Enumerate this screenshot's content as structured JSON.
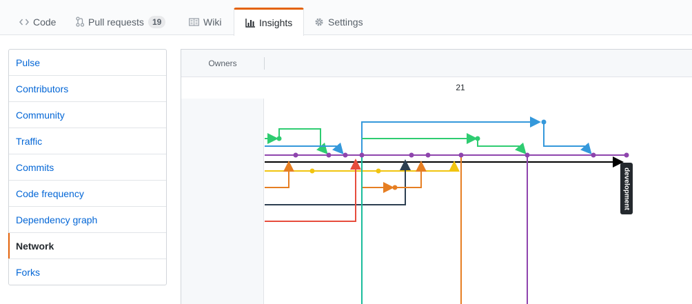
{
  "tabs": [
    {
      "label": "Code",
      "icon": "code-icon"
    },
    {
      "label": "Pull requests",
      "icon": "git-pull-request-icon",
      "count": "19"
    },
    {
      "label": "Wiki",
      "icon": "book-icon"
    },
    {
      "label": "Insights",
      "icon": "graph-icon",
      "selected": true
    },
    {
      "label": "Settings",
      "icon": "gear-icon"
    }
  ],
  "menu": {
    "items": [
      {
        "label": "Pulse"
      },
      {
        "label": "Contributors"
      },
      {
        "label": "Community"
      },
      {
        "label": "Traffic"
      },
      {
        "label": "Commits"
      },
      {
        "label": "Code frequency"
      },
      {
        "label": "Dependency graph"
      },
      {
        "label": "Network",
        "selected": true
      },
      {
        "label": "Forks"
      }
    ]
  },
  "network": {
    "owners_label": "Owners",
    "date_label": "21",
    "branch_label": "development"
  },
  "colors": {
    "accent": "#e36209",
    "link": "#0366d6",
    "purple": "#8e44ad",
    "green": "#2ecc71",
    "blue": "#3498db",
    "yellow": "#f1c40f",
    "orange": "#e67e22",
    "red": "#e74c3c",
    "teal": "#1abc9c",
    "navy": "#2c3e50",
    "black": "#000000"
  }
}
